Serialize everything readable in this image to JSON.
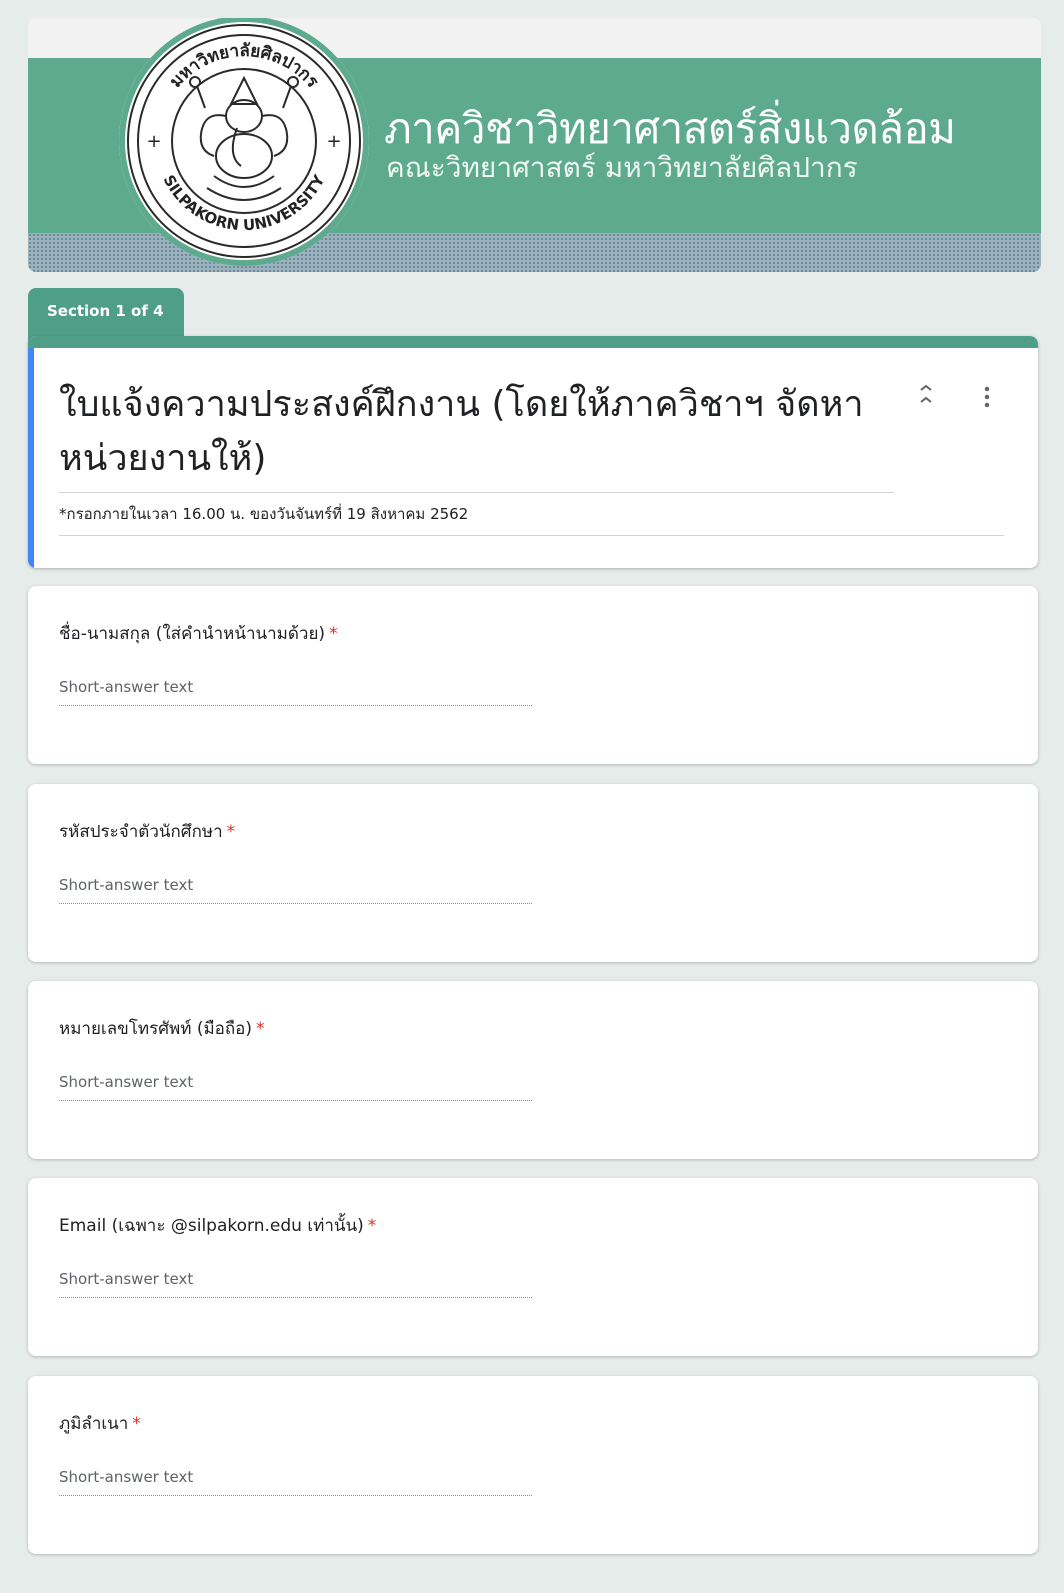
{
  "header": {
    "department": "ภาควิชาวิทยาศาสตร์สิ่งแวดล้อม",
    "faculty": "คณะวิทยาศาสตร์ มหาวิทยาลัยศิลปากร",
    "seal_top_text": "มหาวิทยาลัยศิลปากร",
    "seal_bottom_text": "SILPAKORN UNIVERSITY",
    "colors": {
      "band": "#5eaa8f",
      "accent": "#4f9f87"
    }
  },
  "section": {
    "label": "Section 1 of 4"
  },
  "form": {
    "title": "ใบแจ้งความประสงค์ฝึกงาน (โดยให้ภาควิชาฯ จัดหาหน่วยงานให้)",
    "description": "*กรอกภายในเวลา 16.00 น. ของวันจันทร์ที่ 19 สิงหาคม 2562",
    "icons": {
      "collapse": "collapse-icon",
      "more": "more-vert-icon"
    }
  },
  "questions": [
    {
      "title": "ชื่อ-นามสกุล (ใส่คำนำหน้านามด้วย)",
      "required": "*",
      "placeholder": "Short-answer text"
    },
    {
      "title": "รหัสประจำตัวนักศึกษา",
      "required": "*",
      "placeholder": "Short-answer text"
    },
    {
      "title": "หมายเลขโทรศัพท์ (มือถือ)",
      "required": "*",
      "placeholder": "Short-answer text"
    },
    {
      "title": "Email (เฉพาะ @silpakorn.edu เท่านั้น)",
      "required": "*",
      "placeholder": "Short-answer text"
    },
    {
      "title": "ภูมิลำเนา",
      "required": "*",
      "placeholder": "Short-answer text"
    }
  ]
}
